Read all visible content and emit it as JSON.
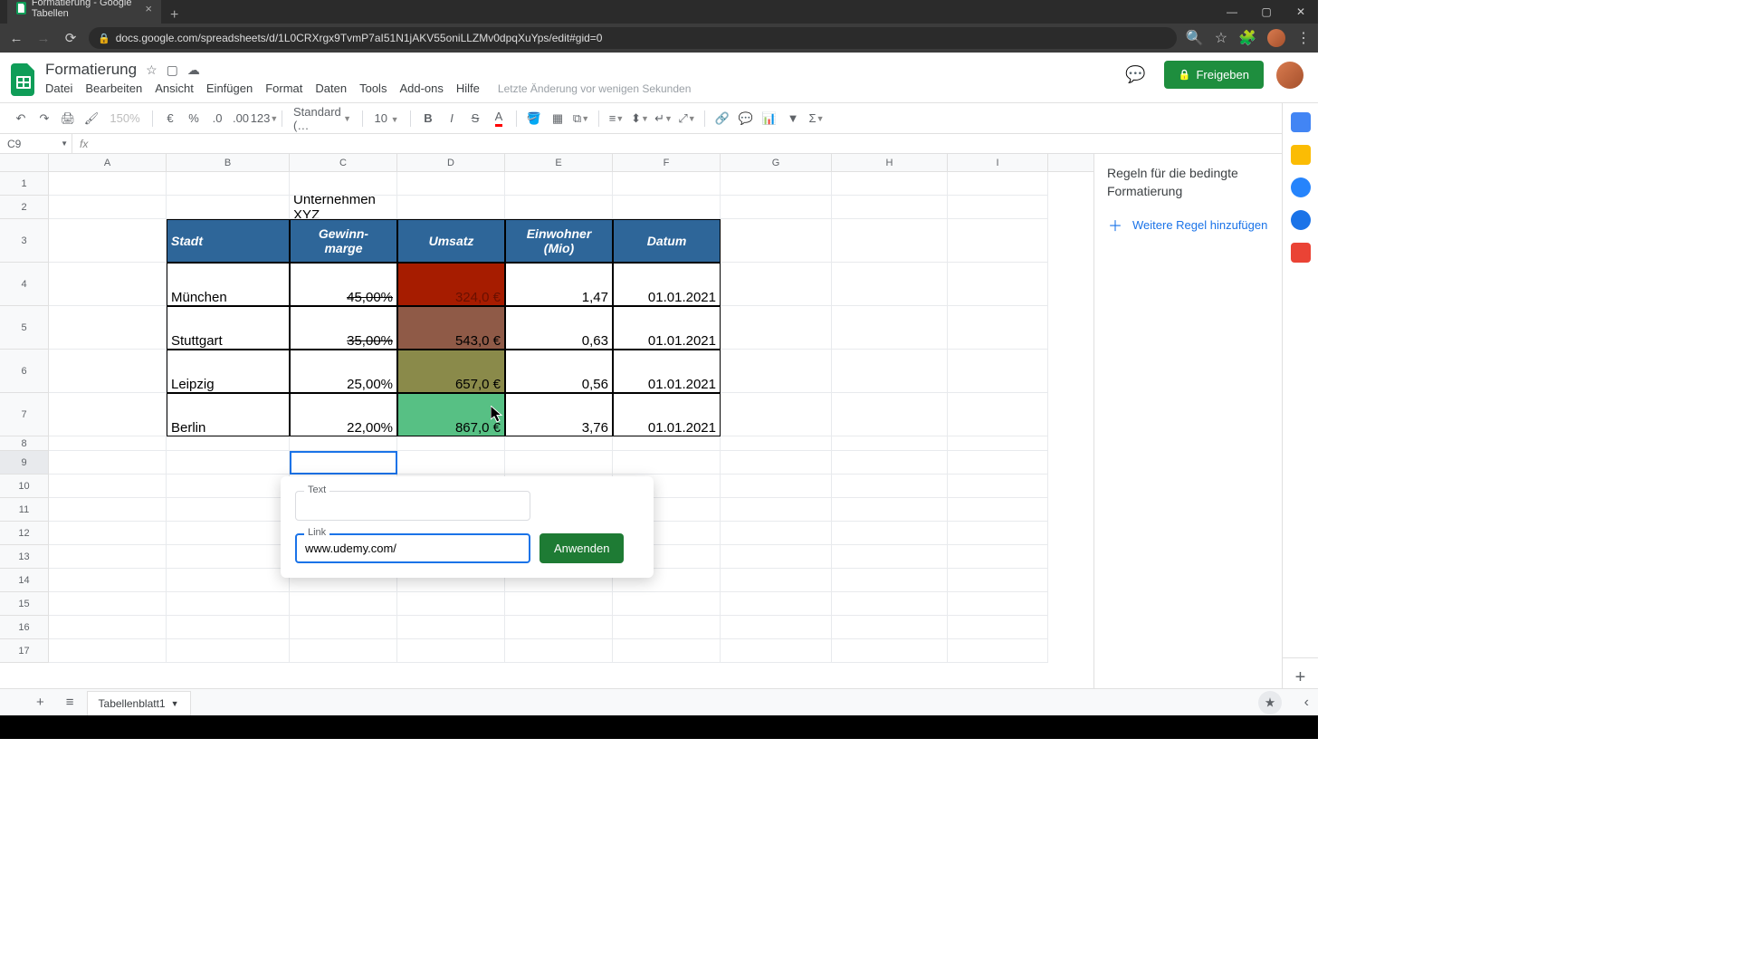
{
  "browser": {
    "tab_title": "Formatierung - Google Tabellen",
    "url": "docs.google.com/spreadsheets/d/1L0CRXrgx9TvmP7aI51N1jAKV55oniLLZMv0dpqXuYps/edit#gid=0"
  },
  "doc": {
    "title": "Formatierung",
    "menu": [
      "Datei",
      "Bearbeiten",
      "Ansicht",
      "Einfügen",
      "Format",
      "Daten",
      "Tools",
      "Add-ons",
      "Hilfe"
    ],
    "last_edit": "Letzte Änderung vor wenigen Sekunden",
    "share_label": "Freigeben"
  },
  "toolbar": {
    "zoom": "150%",
    "font_name": "Standard (…",
    "font_size": "10"
  },
  "formula": {
    "active_cell": "C9"
  },
  "columns": [
    "A",
    "B",
    "C",
    "D",
    "E",
    "F",
    "G",
    "H",
    "I"
  ],
  "rows": [
    "1",
    "2",
    "3",
    "4",
    "5",
    "6",
    "7",
    "8",
    "9",
    "10",
    "11",
    "12",
    "13",
    "14",
    "15",
    "16",
    "17"
  ],
  "sheet": {
    "title_cell": "Unternehmen XYZ",
    "headers": {
      "stadt": "Stadt",
      "marge": "Gewinn-marge",
      "umsatz": "Umsatz",
      "einwohner": "Einwohner (Mio)",
      "datum": "Datum"
    },
    "rows": [
      {
        "stadt": "München",
        "marge": "45,00%",
        "marge_strike": true,
        "umsatz": "324,0 €",
        "umsatz_bg": "darkred",
        "einwohner": "1,47",
        "datum": "01.01.2021"
      },
      {
        "stadt": "Stuttgart",
        "marge": "35,00%",
        "marge_strike": true,
        "umsatz": "543,0 €",
        "umsatz_bg": "brown",
        "einwohner": "0,63",
        "datum": "01.01.2021"
      },
      {
        "stadt": "Leipzig",
        "marge": "25,00%",
        "marge_strike": false,
        "umsatz": "657,0 €",
        "umsatz_bg": "olive",
        "einwohner": "0,56",
        "datum": "01.01.2021"
      },
      {
        "stadt": "Berlin",
        "marge": "22,00%",
        "marge_strike": false,
        "umsatz": "867,0 €",
        "umsatz_bg": "green",
        "einwohner": "3,76",
        "datum": "01.01.2021"
      }
    ]
  },
  "link_dialog": {
    "text_label": "Text",
    "link_label": "Link",
    "link_value": "www.udemy.com/",
    "apply_label": "Anwenden"
  },
  "side_panel": {
    "title": "Regeln für die bedingte Formatierung",
    "add_rule": "Weitere Regel hinzufügen"
  },
  "sheet_tab": "Tabellenblatt1"
}
